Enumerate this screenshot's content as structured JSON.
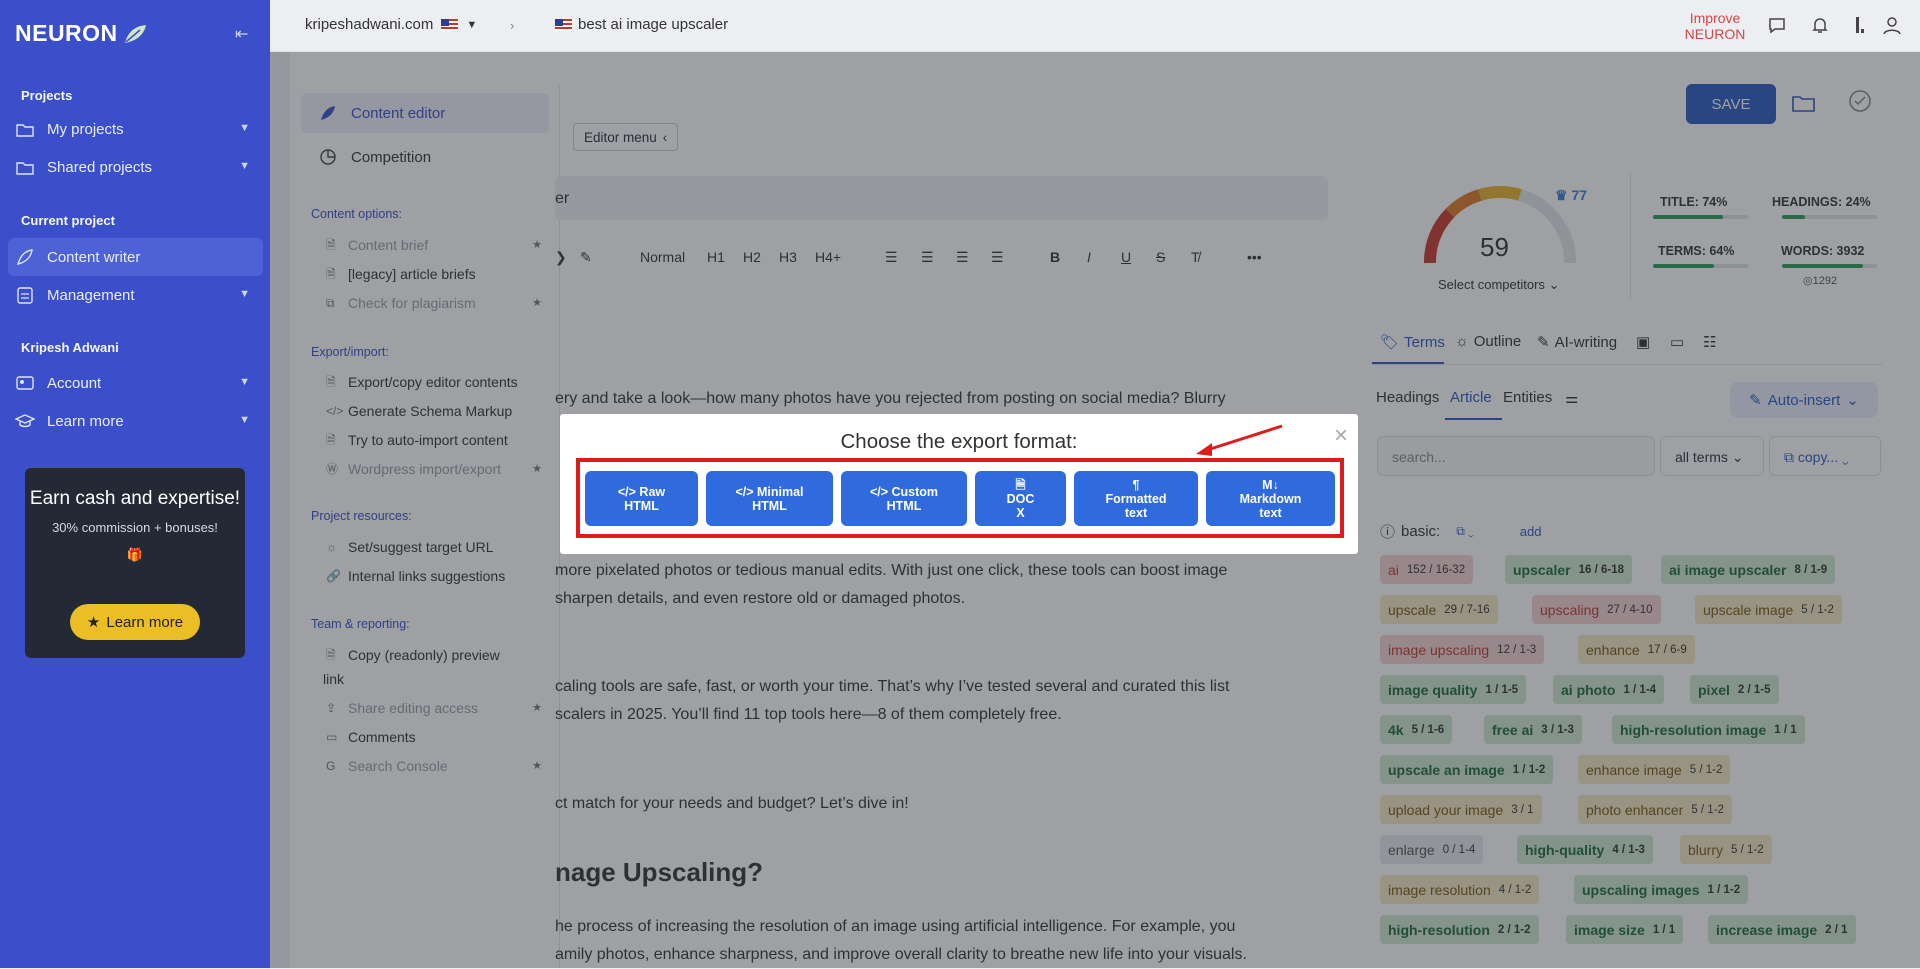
{
  "nav": {
    "logo": "NEURON",
    "sections": {
      "projects": "Projects",
      "current_project": "Current project",
      "user": "Kripesh Adwani"
    },
    "items": {
      "my_projects": "My projects",
      "shared_projects": "Shared projects",
      "content_writer": "Content writer",
      "management": "Management",
      "account": "Account",
      "learn_more": "Learn more"
    },
    "promo": {
      "title": "Earn cash and expertise!",
      "subtitle": "30% commission + bonuses!",
      "button": "Learn more"
    }
  },
  "topbar": {
    "site": "kripeshadwani.com",
    "keyword": "best ai image upscaler",
    "improve": "Improve NEURON"
  },
  "editor_sidebar": {
    "tabs": {
      "content_editor": "Content editor",
      "competition": "Competition"
    },
    "content_options": {
      "heading": "Content options:",
      "items": [
        "Content brief",
        "[legacy] article briefs",
        "Check for plagiarism"
      ]
    },
    "export_import": {
      "heading": "Export/import:",
      "items": [
        "Export/copy editor contents",
        "Generate Schema Markup",
        "Try to auto-import content",
        "Wordpress import/export"
      ]
    },
    "project_resources": {
      "heading": "Project resources:",
      "items": [
        "Set/suggest target URL",
        "Internal links suggestions"
      ]
    },
    "team_reporting": {
      "heading": "Team & reporting:",
      "items": [
        "Copy (readonly) preview",
        "link",
        "Share editing access",
        "Comments",
        "Search Console"
      ]
    }
  },
  "editor": {
    "menu_label": "Editor menu",
    "title_fragment": "er",
    "toolbar": {
      "normal": "Normal",
      "h1": "H1",
      "h2": "H2",
      "h3": "H3",
      "h4": "H4+"
    },
    "body": [
      "ery and take a look—how many photos have you rejected from posting on social media? Blurry",
      "more pixelated photos or tedious manual edits. With just one click, these tools can boost image",
      "sharpen details, and even restore old or damaged photos.",
      "caling tools are safe, fast, or worth your time. That’s why I’ve tested several and curated this list",
      "scalers in 2025. You’ll find 11 top tools here—8 of them completely free.",
      "ct match for your needs and budget? Let’s dive in!",
      "he process of increasing the resolution of an image using artificial intelligence. For example, you",
      "amily photos, enhance sharpness, and improve overall clarity to breathe new life into your visuals."
    ],
    "heading": "nage Upscaling?",
    "save": "SAVE"
  },
  "score_panel": {
    "score": "59",
    "target": "77",
    "select_competitors": "Select competitors",
    "metrics": {
      "title": "TITLE: 74%",
      "title_value": 74,
      "headings": "HEADINGS: 24%",
      "headings_value": 24,
      "terms": "TERMS: 64%",
      "terms_value": 64,
      "words": "WORDS: 3932",
      "words_value": 85,
      "words_target": "1292"
    }
  },
  "right_panel": {
    "tabs": {
      "terms": "Terms",
      "outline": "Outline",
      "ai_writing": "AI-writing"
    },
    "subtabs": {
      "headings": "Headings",
      "article": "Article",
      "entities": "Entities"
    },
    "auto_insert": "Auto-insert",
    "search_placeholder": "search...",
    "filter": "all terms",
    "copy": "copy...",
    "basic_label": "basic:",
    "add": "add",
    "terms": [
      {
        "term": "ai",
        "count": "152 / 16-32",
        "status": "r"
      },
      {
        "term": "upscaler",
        "count": "16 / 6-18",
        "status": "g"
      },
      {
        "term": "ai image upscaler",
        "count": "8 / 1-9",
        "status": "g"
      },
      {
        "term": "upscale",
        "count": "29 / 7-16",
        "status": "y"
      },
      {
        "term": "upscaling",
        "count": "27 / 4-10",
        "status": "r"
      },
      {
        "term": "upscale image",
        "count": "5 / 1-2",
        "status": "y"
      },
      {
        "term": "image upscaling",
        "count": "12 / 1-3",
        "status": "r"
      },
      {
        "term": "enhance",
        "count": "17 / 6-9",
        "status": "y"
      },
      {
        "term": "image quality",
        "count": "1 / 1-5",
        "status": "g"
      },
      {
        "term": "ai photo",
        "count": "1 / 1-4",
        "status": "g"
      },
      {
        "term": "pixel",
        "count": "2 / 1-5",
        "status": "g"
      },
      {
        "term": "4k",
        "count": "5 / 1-6",
        "status": "g"
      },
      {
        "term": "free ai",
        "count": "3 / 1-3",
        "status": "g"
      },
      {
        "term": "high-resolution image",
        "count": "1 / 1",
        "status": "g"
      },
      {
        "term": "upscale an image",
        "count": "1 / 1-2",
        "status": "g"
      },
      {
        "term": "enhance image",
        "count": "5 / 1-2",
        "status": "y"
      },
      {
        "term": "upload your image",
        "count": "3 / 1",
        "status": "y"
      },
      {
        "term": "photo enhancer",
        "count": "5 / 1-2",
        "status": "y"
      },
      {
        "term": "enlarge",
        "count": "0 / 1-4",
        "status": "grey"
      },
      {
        "term": "high-quality",
        "count": "4 / 1-3",
        "status": "g"
      },
      {
        "term": "blurry",
        "count": "5 / 1-2",
        "status": "y"
      },
      {
        "term": "image resolution",
        "count": "4 / 1-2",
        "status": "y"
      },
      {
        "term": "upscaling images",
        "count": "1 / 1-2",
        "status": "g"
      },
      {
        "term": "high-resolution",
        "count": "2 / 1-2",
        "status": "g"
      },
      {
        "term": "image size",
        "count": "1 / 1",
        "status": "g"
      },
      {
        "term": "increase image",
        "count": "2 / 1",
        "status": "g"
      }
    ]
  },
  "export_dialog": {
    "title": "Choose the export format:",
    "close": "×",
    "buttons": [
      {
        "line1": "Raw",
        "line2": "HTML",
        "icon": "code-icon"
      },
      {
        "line1": "Minimal",
        "line2": "HTML",
        "icon": "code-icon"
      },
      {
        "line1": "Custom",
        "line2": "HTML",
        "icon": "code-icon"
      },
      {
        "line1": "DOC",
        "line2": "X",
        "icon": "doc-icon"
      },
      {
        "line1": "Formatted",
        "line2": "text",
        "icon": "paragraph-icon"
      },
      {
        "line1": "Markdown",
        "line2": "text",
        "icon": "markdown-icon"
      }
    ]
  }
}
